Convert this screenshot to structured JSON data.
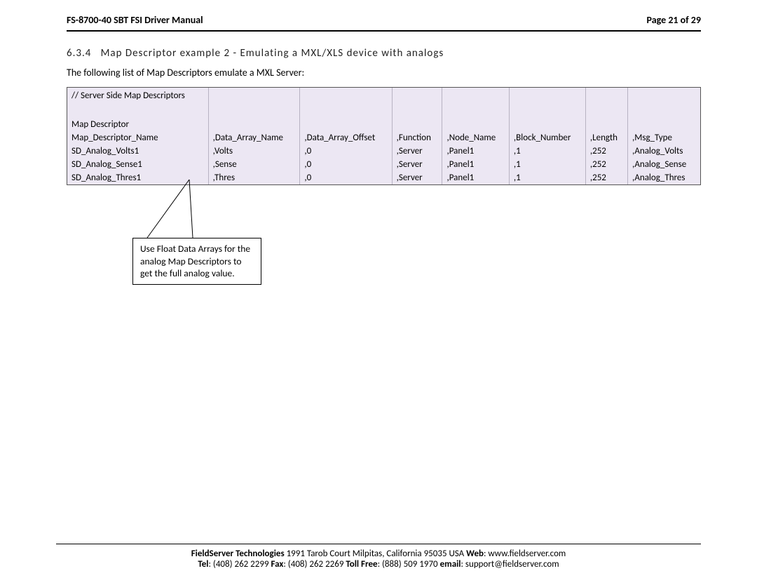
{
  "header": {
    "left": "FS-8700-40 SBT FSI Driver Manual",
    "right": "Page 21 of 29"
  },
  "section": {
    "number": "6.3.4",
    "title": "Map Descriptor example 2 - Emulating a MXL/XLS device with analogs"
  },
  "lead": "The following list of Map Descriptors emulate a MXL Server:",
  "table": {
    "comment": "// Server Side Map Descriptors",
    "group_label": "Map Descriptor",
    "headers": [
      "Map_Descriptor_Name",
      ",Data_Array_Name",
      ",Data_Array_Offset",
      ",Function",
      ",Node_Name",
      ",Block_Number",
      ",Length",
      ",Msg_Type"
    ],
    "rows": [
      [
        "SD_Analog_Volts1",
        ",Volts",
        ",0",
        ",Server",
        ",Panel1",
        ",1",
        ",252",
        ",Analog_Volts"
      ],
      [
        "SD_Analog_Sense1",
        ",Sense",
        ",0",
        ",Server",
        ",Panel1",
        ",1",
        ",252",
        ",Analog_Sense"
      ],
      [
        "SD_Analog_Thres1",
        ",Thres",
        ",0",
        ",Server",
        ",Panel1",
        ",1",
        ",252",
        ",Analog_Thres"
      ]
    ]
  },
  "callout": "Use Float Data Arrays for the analog Map Descriptors to get the full analog value.",
  "footer": {
    "line1_bold": "FieldServer Technologies",
    "line1_rest": " 1991 Tarob Court Milpitas, California 95035 USA  ",
    "web_label": "Web",
    "web_value": ": www.fieldserver.com",
    "tel_label": "Tel",
    "tel_value": ": (408) 262 2299  ",
    "fax_label": "Fax",
    "fax_value": ": (408) 262 2269  ",
    "tollfree_label": "Toll Free",
    "tollfree_value": ": (888) 509 1970  ",
    "email_label": "email",
    "email_value": ": support@fieldserver.com"
  }
}
